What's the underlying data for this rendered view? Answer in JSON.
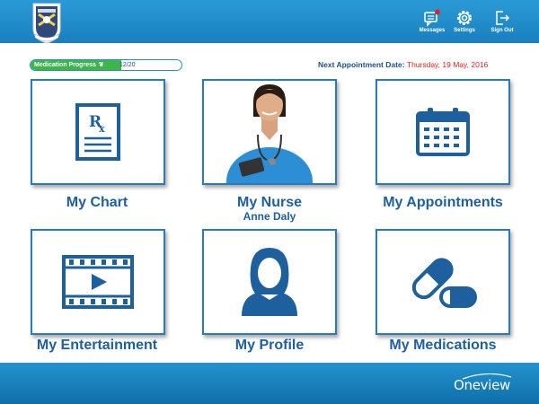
{
  "header": {
    "actions": [
      {
        "label": "Messages",
        "icon": "messages-icon"
      },
      {
        "label": "Settings",
        "icon": "settings-icon"
      },
      {
        "label": "Sign Out",
        "icon": "sign-out-icon"
      }
    ]
  },
  "progress": {
    "label": "Medication Progress",
    "count": "12/20",
    "value": 0.6
  },
  "appointment": {
    "label": "Next Appointment Date:",
    "date": "Thursday, 19 May, 2016"
  },
  "tiles": [
    {
      "title": "My Chart",
      "icon": "prescription-chart-icon"
    },
    {
      "title": "My Nurse",
      "subtitle": "Anne Daly",
      "icon": "nurse-photo"
    },
    {
      "title": "My Appointments",
      "icon": "calendar-icon"
    },
    {
      "title": "My Entertainment",
      "icon": "video-film-icon"
    },
    {
      "title": "My Profile",
      "icon": "profile-icon"
    },
    {
      "title": "My Medications",
      "icon": "pills-icon"
    }
  ],
  "footer": {
    "logo": "Oneview"
  },
  "colors": {
    "accent": "#1e5f9e",
    "header": "#1a8ccb",
    "progress": "#3db649",
    "date": "#e1231f"
  }
}
